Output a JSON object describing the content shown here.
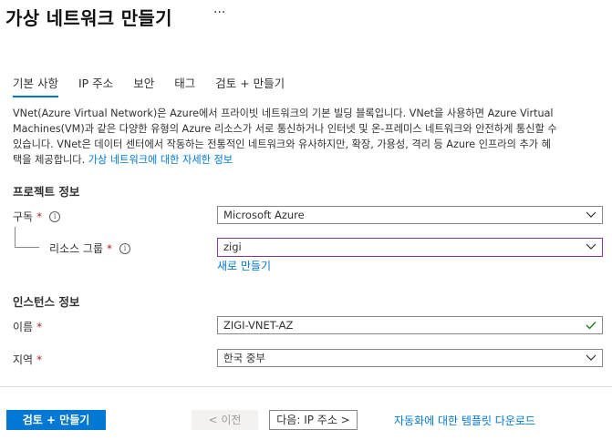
{
  "header": {
    "title": "가상 네트워크 만들기",
    "more": "···"
  },
  "tabs": [
    {
      "label": "기본 사항"
    },
    {
      "label": "IP 주소"
    },
    {
      "label": "보안"
    },
    {
      "label": "태그"
    },
    {
      "label": "검토 + 만들기"
    }
  ],
  "description": {
    "line1": "VNet(Azure Virtual Network)은 Azure에서 프라이빗 네트워크의 기본 빌딩 블록입니다. VNet을 사용하면 Azure Virtual",
    "line2": "Machines(VM)과 같은 다양한 유형의 Azure 리소스가 서로 통신하거나 인터넷 및 온-프레미스 네트워크와 안전하게 통신할 수",
    "line3": "있습니다. VNet은 데이터 센터에서 작동하는 전통적인 네트워크와 유사하지만, 확장, 가용성, 격리 등 Azure 인프라의 추가 혜",
    "line4": "택을 제공합니다.",
    "link": "가상 네트워크에 대한 자세한 정보"
  },
  "project": {
    "heading": "프로젝트 정보",
    "subscription_label": "구독",
    "subscription_value": "Microsoft Azure",
    "rg_label": "리소스 그룹",
    "rg_value": "zigi",
    "create_new": "새로 만들기"
  },
  "instance": {
    "heading": "인스턴스 정보",
    "name_label": "이름",
    "name_value": "ZIGI-VNET-AZ",
    "region_label": "지역",
    "region_value": "한국 중부"
  },
  "footer": {
    "review_create": "검토 + 만들기",
    "previous": "< 이전",
    "next": "다음: IP 주소 >",
    "download_template": "자동화에 대한 템플릿 다운로드"
  },
  "required_mark": "*",
  "info_glyph": "i",
  "colors": {
    "accent": "#0078d4",
    "focus_border": "#7d3c98",
    "valid": "#107c10",
    "required": "#a4262c"
  }
}
